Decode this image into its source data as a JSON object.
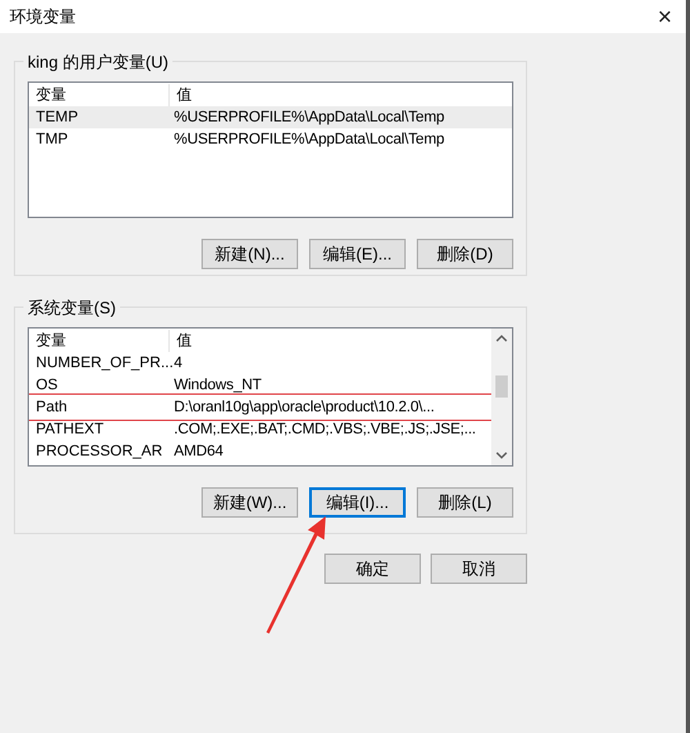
{
  "window": {
    "title": "环境变量",
    "close": "×"
  },
  "user_vars": {
    "label": "king 的用户变量(U)",
    "columns": [
      "变量",
      "值"
    ],
    "rows": [
      {
        "name": "TEMP",
        "value": "%USERPROFILE%\\AppData\\Local\\Temp",
        "selected": true,
        "highlighted": false
      },
      {
        "name": "TMP",
        "value": "%USERPROFILE%\\AppData\\Local\\Temp",
        "selected": false,
        "highlighted": false
      }
    ],
    "buttons": [
      {
        "label": "新建(N)...",
        "focused": false
      },
      {
        "label": "编辑(E)...",
        "focused": false
      },
      {
        "label": "删除(D)",
        "focused": false
      }
    ]
  },
  "system_vars": {
    "label": "系统变量(S)",
    "columns": [
      "变量",
      "值"
    ],
    "rows": [
      {
        "name": "NUMBER_OF_PR...",
        "value": "4",
        "selected": false,
        "highlighted": false
      },
      {
        "name": "OS",
        "value": "Windows_NT",
        "selected": false,
        "highlighted": false
      },
      {
        "name": "Path",
        "value": "D:\\oranl10g\\app\\oracle\\product\\10.2.0\\...",
        "selected": false,
        "highlighted": true
      },
      {
        "name": "PATHEXT",
        "value": ".COM;.EXE;.BAT;.CMD;.VBS;.VBE;.JS;.JSE;...",
        "selected": false,
        "highlighted": false
      },
      {
        "name": "PROCESSOR_AR",
        "value": "AMD64",
        "selected": false,
        "highlighted": false
      }
    ],
    "buttons": [
      {
        "label": "新建(W)...",
        "focused": false
      },
      {
        "label": "编辑(I)...",
        "focused": true
      },
      {
        "label": "删除(L)",
        "focused": false
      }
    ]
  },
  "dialog_buttons": [
    {
      "label": "确定",
      "focused": false
    },
    {
      "label": "取消",
      "focused": false
    }
  ]
}
